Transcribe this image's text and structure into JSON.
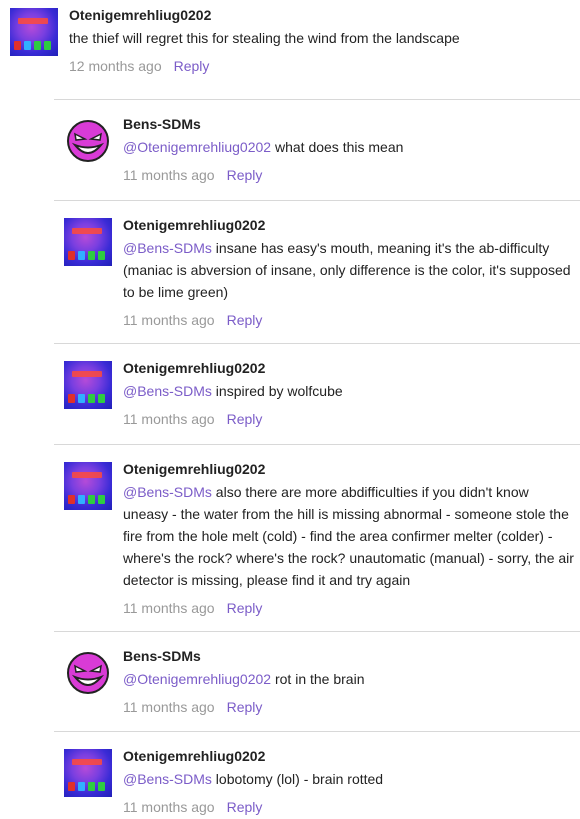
{
  "comments": [
    {
      "author": "Otenigemrehliug0202",
      "avatar": "purple-gradient-avatar",
      "mention": "",
      "text": "the thief will regret this for stealing the wind from the landscape",
      "time": "12 months ago",
      "reply": "Reply"
    },
    {
      "author": "Bens-SDMs",
      "avatar": "magenta-demon-face-avatar",
      "mention": "@Otenigemrehliug0202",
      "text": " what does this mean",
      "time": "11 months ago",
      "reply": "Reply"
    },
    {
      "author": "Otenigemrehliug0202",
      "avatar": "purple-gradient-avatar",
      "mention": "@Bens-SDMs",
      "text": " insane has easy's mouth, meaning it's the ab-difficulty (maniac is abversion of insane, only difference is the color, it's supposed to be lime green)",
      "time": "11 months ago",
      "reply": "Reply"
    },
    {
      "author": "Otenigemrehliug0202",
      "avatar": "purple-gradient-avatar",
      "mention": "@Bens-SDMs",
      "text": " inspired by wolfcube",
      "time": "11 months ago",
      "reply": "Reply"
    },
    {
      "author": "Otenigemrehliug0202",
      "avatar": "purple-gradient-avatar",
      "mention": "@Bens-SDMs",
      "text": " also there are more abdifficulties if you didn't know uneasy - the water from the hill is missing abnormal - someone stole the fire from the hole melt (cold) - find the area confirmer melter (colder) - where's the rock? where's the rock? unautomatic (manual) - sorry, the air detector is missing, please find it and try again",
      "time": "11 months ago",
      "reply": "Reply"
    },
    {
      "author": "Bens-SDMs",
      "avatar": "magenta-demon-face-avatar",
      "mention": "@Otenigemrehliug0202",
      "text": " rot in the brain",
      "time": "11 months ago",
      "reply": "Reply"
    },
    {
      "author": "Otenigemrehliug0202",
      "avatar": "purple-gradient-avatar",
      "mention": "@Bens-SDMs",
      "text": " lobotomy (lol) - brain rotted",
      "time": "11 months ago",
      "reply": "Reply"
    }
  ]
}
